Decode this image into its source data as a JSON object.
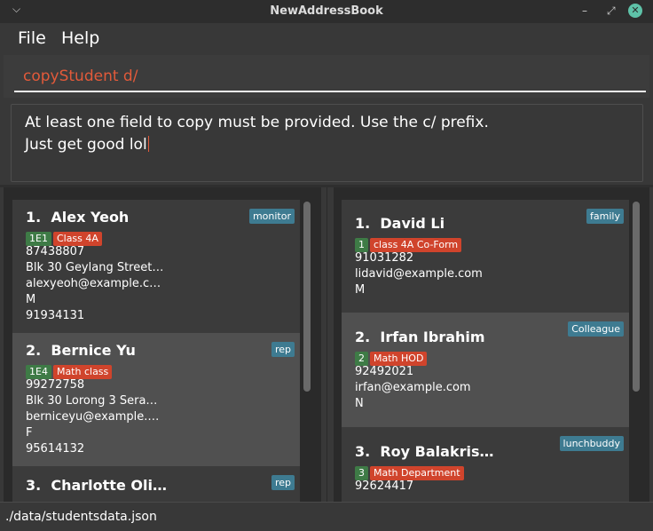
{
  "window": {
    "title": "NewAddressBook"
  },
  "menu": {
    "file": "File",
    "help": "Help"
  },
  "command": {
    "value": "copyStudent d/"
  },
  "result": {
    "line1": "At least one field to copy must be provided. Use the c/ prefix.",
    "line2": "Just get good lol"
  },
  "students": [
    {
      "index": "1.",
      "name": "Alex Yeoh",
      "tags": [
        {
          "label": "1E1",
          "color": "green"
        },
        {
          "label": "Class 4A",
          "color": "red"
        }
      ],
      "badge": "monitor",
      "lines": [
        "87438807",
        "Blk 30 Geylang Street…",
        "alexyeoh@example.c…",
        "M",
        "91934131"
      ]
    },
    {
      "index": "2.",
      "name": "Bernice Yu",
      "tags": [
        {
          "label": "1E4",
          "color": "green"
        },
        {
          "label": "Math class",
          "color": "red"
        }
      ],
      "badge": "rep",
      "lines": [
        "99272758",
        "Blk 30 Lorong 3 Sera…",
        "berniceyu@example.…",
        "F",
        "95614132"
      ]
    },
    {
      "index": "3.",
      "name": "Charlotte Oli…",
      "tags": [],
      "badge": "rep",
      "lines": []
    }
  ],
  "teachers": [
    {
      "index": "1.",
      "name": "David Li",
      "tags": [
        {
          "label": "1",
          "color": "green"
        },
        {
          "label": "class 4A Co-Form",
          "color": "red"
        }
      ],
      "badge": "family",
      "lines": [
        "91031282",
        "lidavid@example.com",
        "M"
      ]
    },
    {
      "index": "2.",
      "name": "Irfan Ibrahim",
      "tags": [
        {
          "label": "2",
          "color": "green"
        },
        {
          "label": "Math HOD",
          "color": "red"
        }
      ],
      "badge": "Colleague",
      "lines": [
        "92492021",
        "irfan@example.com",
        "N"
      ]
    },
    {
      "index": "3.",
      "name": "Roy Balakris…",
      "tags": [
        {
          "label": "3",
          "color": "green"
        },
        {
          "label": "Math Department",
          "color": "red"
        }
      ],
      "badge": "lunchbuddy",
      "lines": [
        "92624417"
      ]
    }
  ],
  "status": {
    "path": "./data/studentsdata.json"
  },
  "colors": {
    "accent_error": "#e25a3a",
    "tag_green": "#3e7b46",
    "tag_red": "#d0442c",
    "badge_blue": "#3e7b91"
  },
  "icons": {
    "title_menu": "chevron-down-icon",
    "minimize": "minimize-icon",
    "maximize": "maximize-icon",
    "close": "close-icon"
  }
}
